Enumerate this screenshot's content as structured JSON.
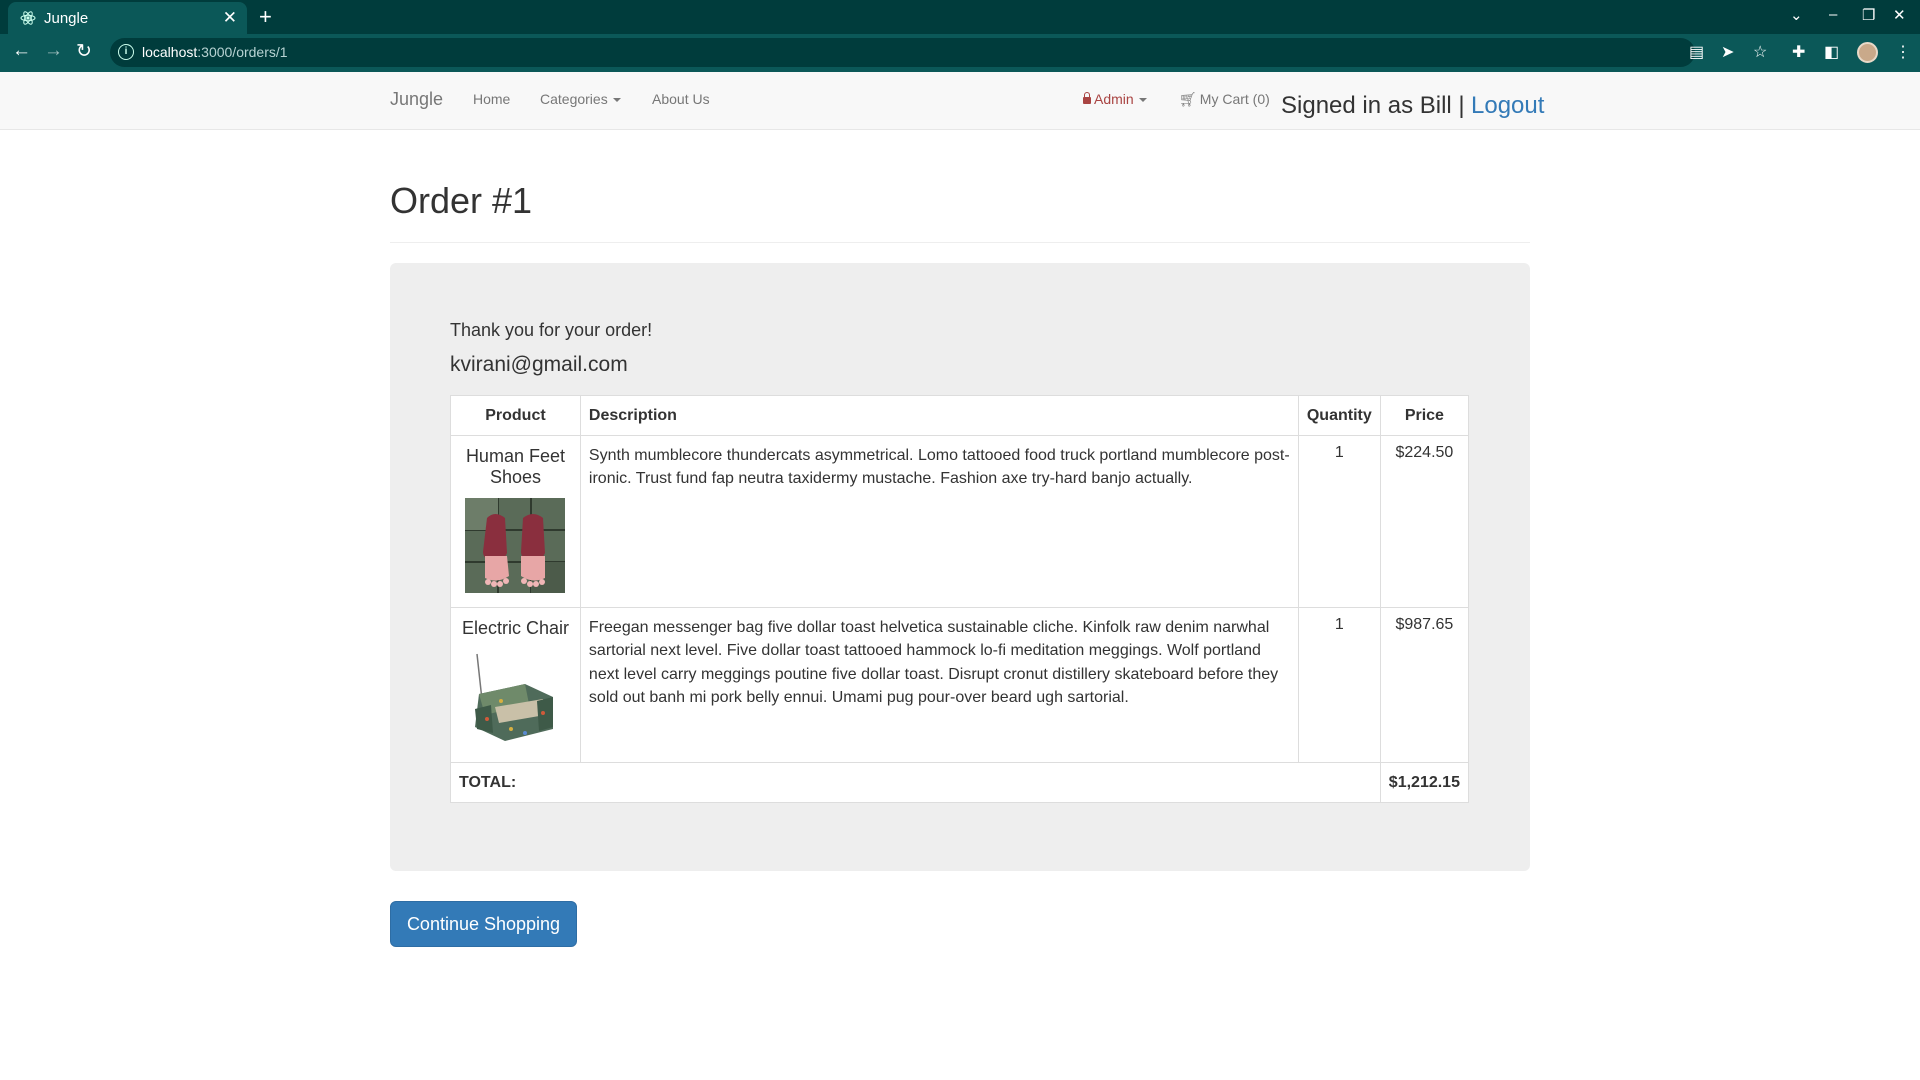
{
  "browser": {
    "tab_title": "Jungle",
    "url_host": "localhost",
    "url_path": ":3000/orders/1"
  },
  "navbar": {
    "brand": "Jungle",
    "home": "Home",
    "categories": "Categories",
    "about": "About Us",
    "admin": "Admin",
    "cart": "My Cart (0)",
    "signed_in": "Signed in as Bill |",
    "logout": "Logout"
  },
  "order": {
    "title": "Order #1",
    "thanks": "Thank you for your order!",
    "email": "kvirani@gmail.com",
    "headers": {
      "product": "Product",
      "description": "Description",
      "quantity": "Quantity",
      "price": "Price"
    },
    "items": [
      {
        "name": "Human Feet Shoes",
        "description": "Synth mumblecore thundercats asymmetrical. Lomo tattooed food truck portland mumblecore post-ironic. Trust fund fap neutra taxidermy mustache. Fashion axe try-hard banjo actually.",
        "quantity": "1",
        "price": "$224.50"
      },
      {
        "name": "Electric Chair",
        "description": "Freegan messenger bag five dollar toast helvetica sustainable cliche. Kinfolk raw denim narwhal sartorial next level. Five dollar toast tattooed hammock lo-fi meditation meggings. Wolf portland next level carry meggings poutine five dollar toast. Disrupt cronut distillery skateboard before they sold out banh mi pork belly ennui. Umami pug pour-over beard ugh sartorial.",
        "quantity": "1",
        "price": "$987.65"
      }
    ],
    "total_label": "TOTAL:",
    "total_value": "$1,212.15"
  },
  "buttons": {
    "continue": "Continue Shopping"
  },
  "colors": {
    "chrome_dark": "#003c3c",
    "chrome_tab": "#0b5858",
    "link_blue": "#337ab7",
    "admin_red": "#a94442",
    "jumbotron": "#eeeeee"
  }
}
